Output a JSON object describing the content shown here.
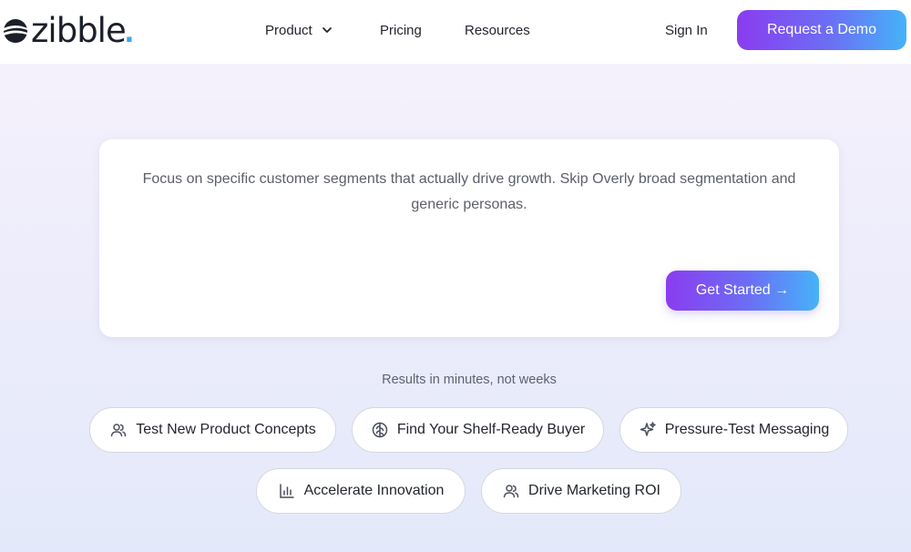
{
  "header": {
    "logo_text": "zibble",
    "logo_dot": ".",
    "nav": {
      "product": "Product",
      "pricing": "Pricing",
      "resources": "Resources",
      "sign_in": "Sign In"
    },
    "demo_button": "Request a Demo"
  },
  "hero": {
    "description": "Focus on specific customer segments that actually drive growth. Skip Overly broad segmentation and generic personas.",
    "cta": "Get Started →"
  },
  "results_caption": "Results in minutes, not weeks",
  "pills": [
    {
      "label": "Test New Product Concepts",
      "icon": "users-icon"
    },
    {
      "label": "Find Your Shelf-Ready Buyer",
      "icon": "brain-icon"
    },
    {
      "label": "Pressure-Test Messaging",
      "icon": "sparkles-icon"
    },
    {
      "label": "Accelerate Innovation",
      "icon": "bar-chart-icon"
    },
    {
      "label": "Drive Marketing ROI",
      "icon": "users-icon"
    }
  ],
  "colors": {
    "accent_gradient_start": "#8a3cf0",
    "accent_gradient_end": "#45b3f9",
    "logo_dot": "#3ba7f0"
  }
}
